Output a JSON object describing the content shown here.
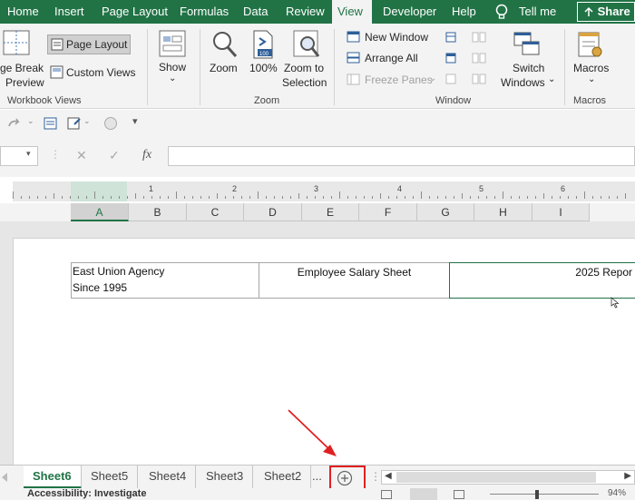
{
  "ribbon_tabs": [
    "Home",
    "Insert",
    "Page Layout",
    "Formulas",
    "Data",
    "Review",
    "View",
    "Developer",
    "Help"
  ],
  "tell_me": "Tell me",
  "share": "Share",
  "workbook_views": {
    "page_break_line1": "ge Break",
    "page_break_line2": "Preview",
    "page_layout": "Page Layout",
    "custom_views": "Custom Views",
    "group": "Workbook Views"
  },
  "show": {
    "label": "Show"
  },
  "zoom": {
    "zoom": "Zoom",
    "hundred": "100%",
    "zoom_sel_1": "Zoom to",
    "zoom_sel_2": "Selection",
    "group": "Zoom"
  },
  "window": {
    "new_window": "New Window",
    "arrange_all": "Arrange All",
    "freeze_panes": "Freeze Panes",
    "switch_1": "Switch",
    "switch_2": "Windows",
    "group": "Window"
  },
  "macros": {
    "label": "Macros",
    "group": "Macros"
  },
  "formula": {
    "fx": "fx"
  },
  "ruler_numbers": [
    "1",
    "2",
    "3",
    "4",
    "5",
    "6"
  ],
  "columns": [
    "A",
    "B",
    "C",
    "D",
    "E",
    "F",
    "G",
    "H",
    "I"
  ],
  "cells": {
    "a1_line1": "East Union Agency",
    "a1_line2": "Since 1995",
    "d1": "Employee Salary Sheet",
    "g1": "2025 Repor"
  },
  "sheets": [
    "Sheet6",
    "Sheet5",
    "Sheet4",
    "Sheet3",
    "Sheet2",
    "..."
  ],
  "status": {
    "accessibility": "Accessibility: Investigate",
    "zoom": "94%"
  },
  "colors": {
    "accent": "#217346",
    "annotation": "#e02020"
  }
}
